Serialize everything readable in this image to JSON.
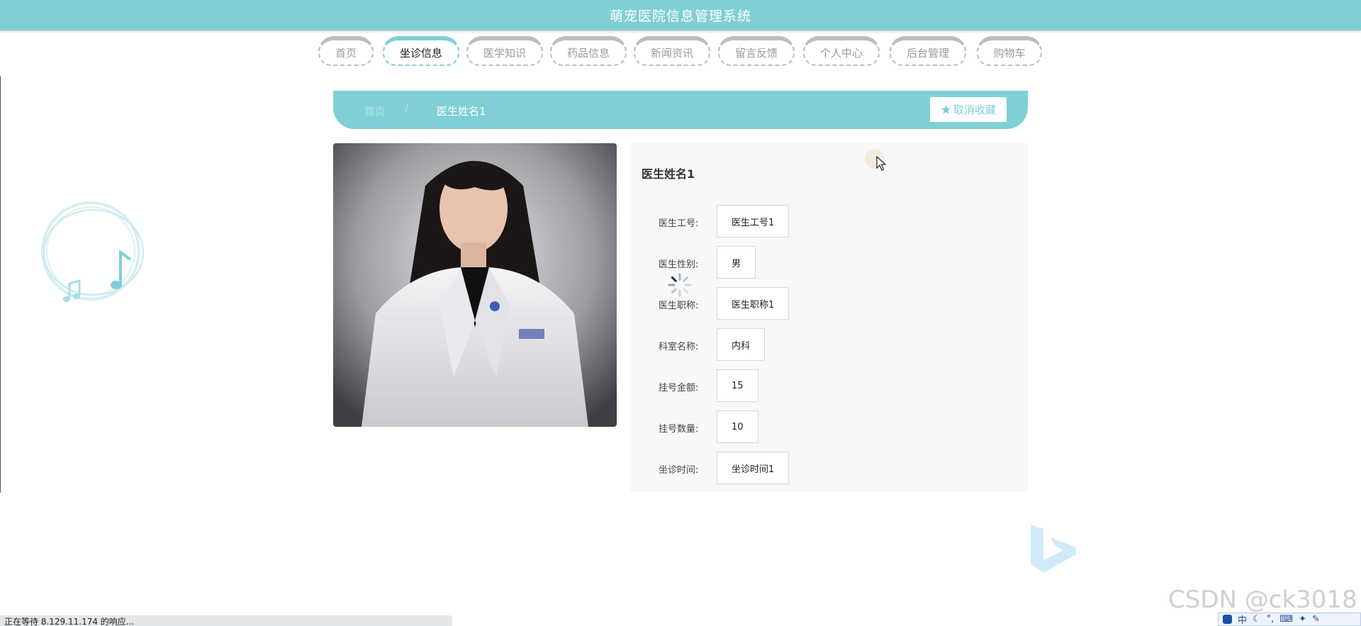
{
  "header": {
    "title": "萌宠医院信息管理系统"
  },
  "nav": {
    "tabs": [
      {
        "label": "首页",
        "active": false
      },
      {
        "label": "坐诊信息",
        "active": true
      },
      {
        "label": "医学知识",
        "active": false
      },
      {
        "label": "药品信息",
        "active": false
      },
      {
        "label": "新闻资讯",
        "active": false
      },
      {
        "label": "留言反馈",
        "active": false
      },
      {
        "label": "个人中心",
        "active": false
      },
      {
        "label": "后台管理",
        "active": false
      },
      {
        "label": "购物车",
        "active": false
      }
    ]
  },
  "breadcrumb": {
    "home": "首页",
    "separator": "/",
    "current": "医生姓名1"
  },
  "favorite": {
    "icon": "star-icon",
    "label": "取消收藏"
  },
  "doctor": {
    "name": "医生姓名1",
    "fields": [
      {
        "label": "医生工号:",
        "value": "医生工号1"
      },
      {
        "label": "医生性别:",
        "value": "男"
      },
      {
        "label": "医生职称:",
        "value": "医生职称1"
      },
      {
        "label": "科室名称:",
        "value": "内科"
      },
      {
        "label": "挂号金额:",
        "value": "15"
      },
      {
        "label": "挂号数量:",
        "value": "10"
      },
      {
        "label": "坐诊时间:",
        "value": "坐诊时间1"
      }
    ]
  },
  "status_bar": {
    "text": "正在等待 8.129.11.174 的响应..."
  },
  "watermark": {
    "text": "CSDN @ck3018"
  },
  "ime": {
    "mode": "中"
  },
  "colors": {
    "primary": "#80cfd6",
    "panel": "#f8f8f8"
  }
}
